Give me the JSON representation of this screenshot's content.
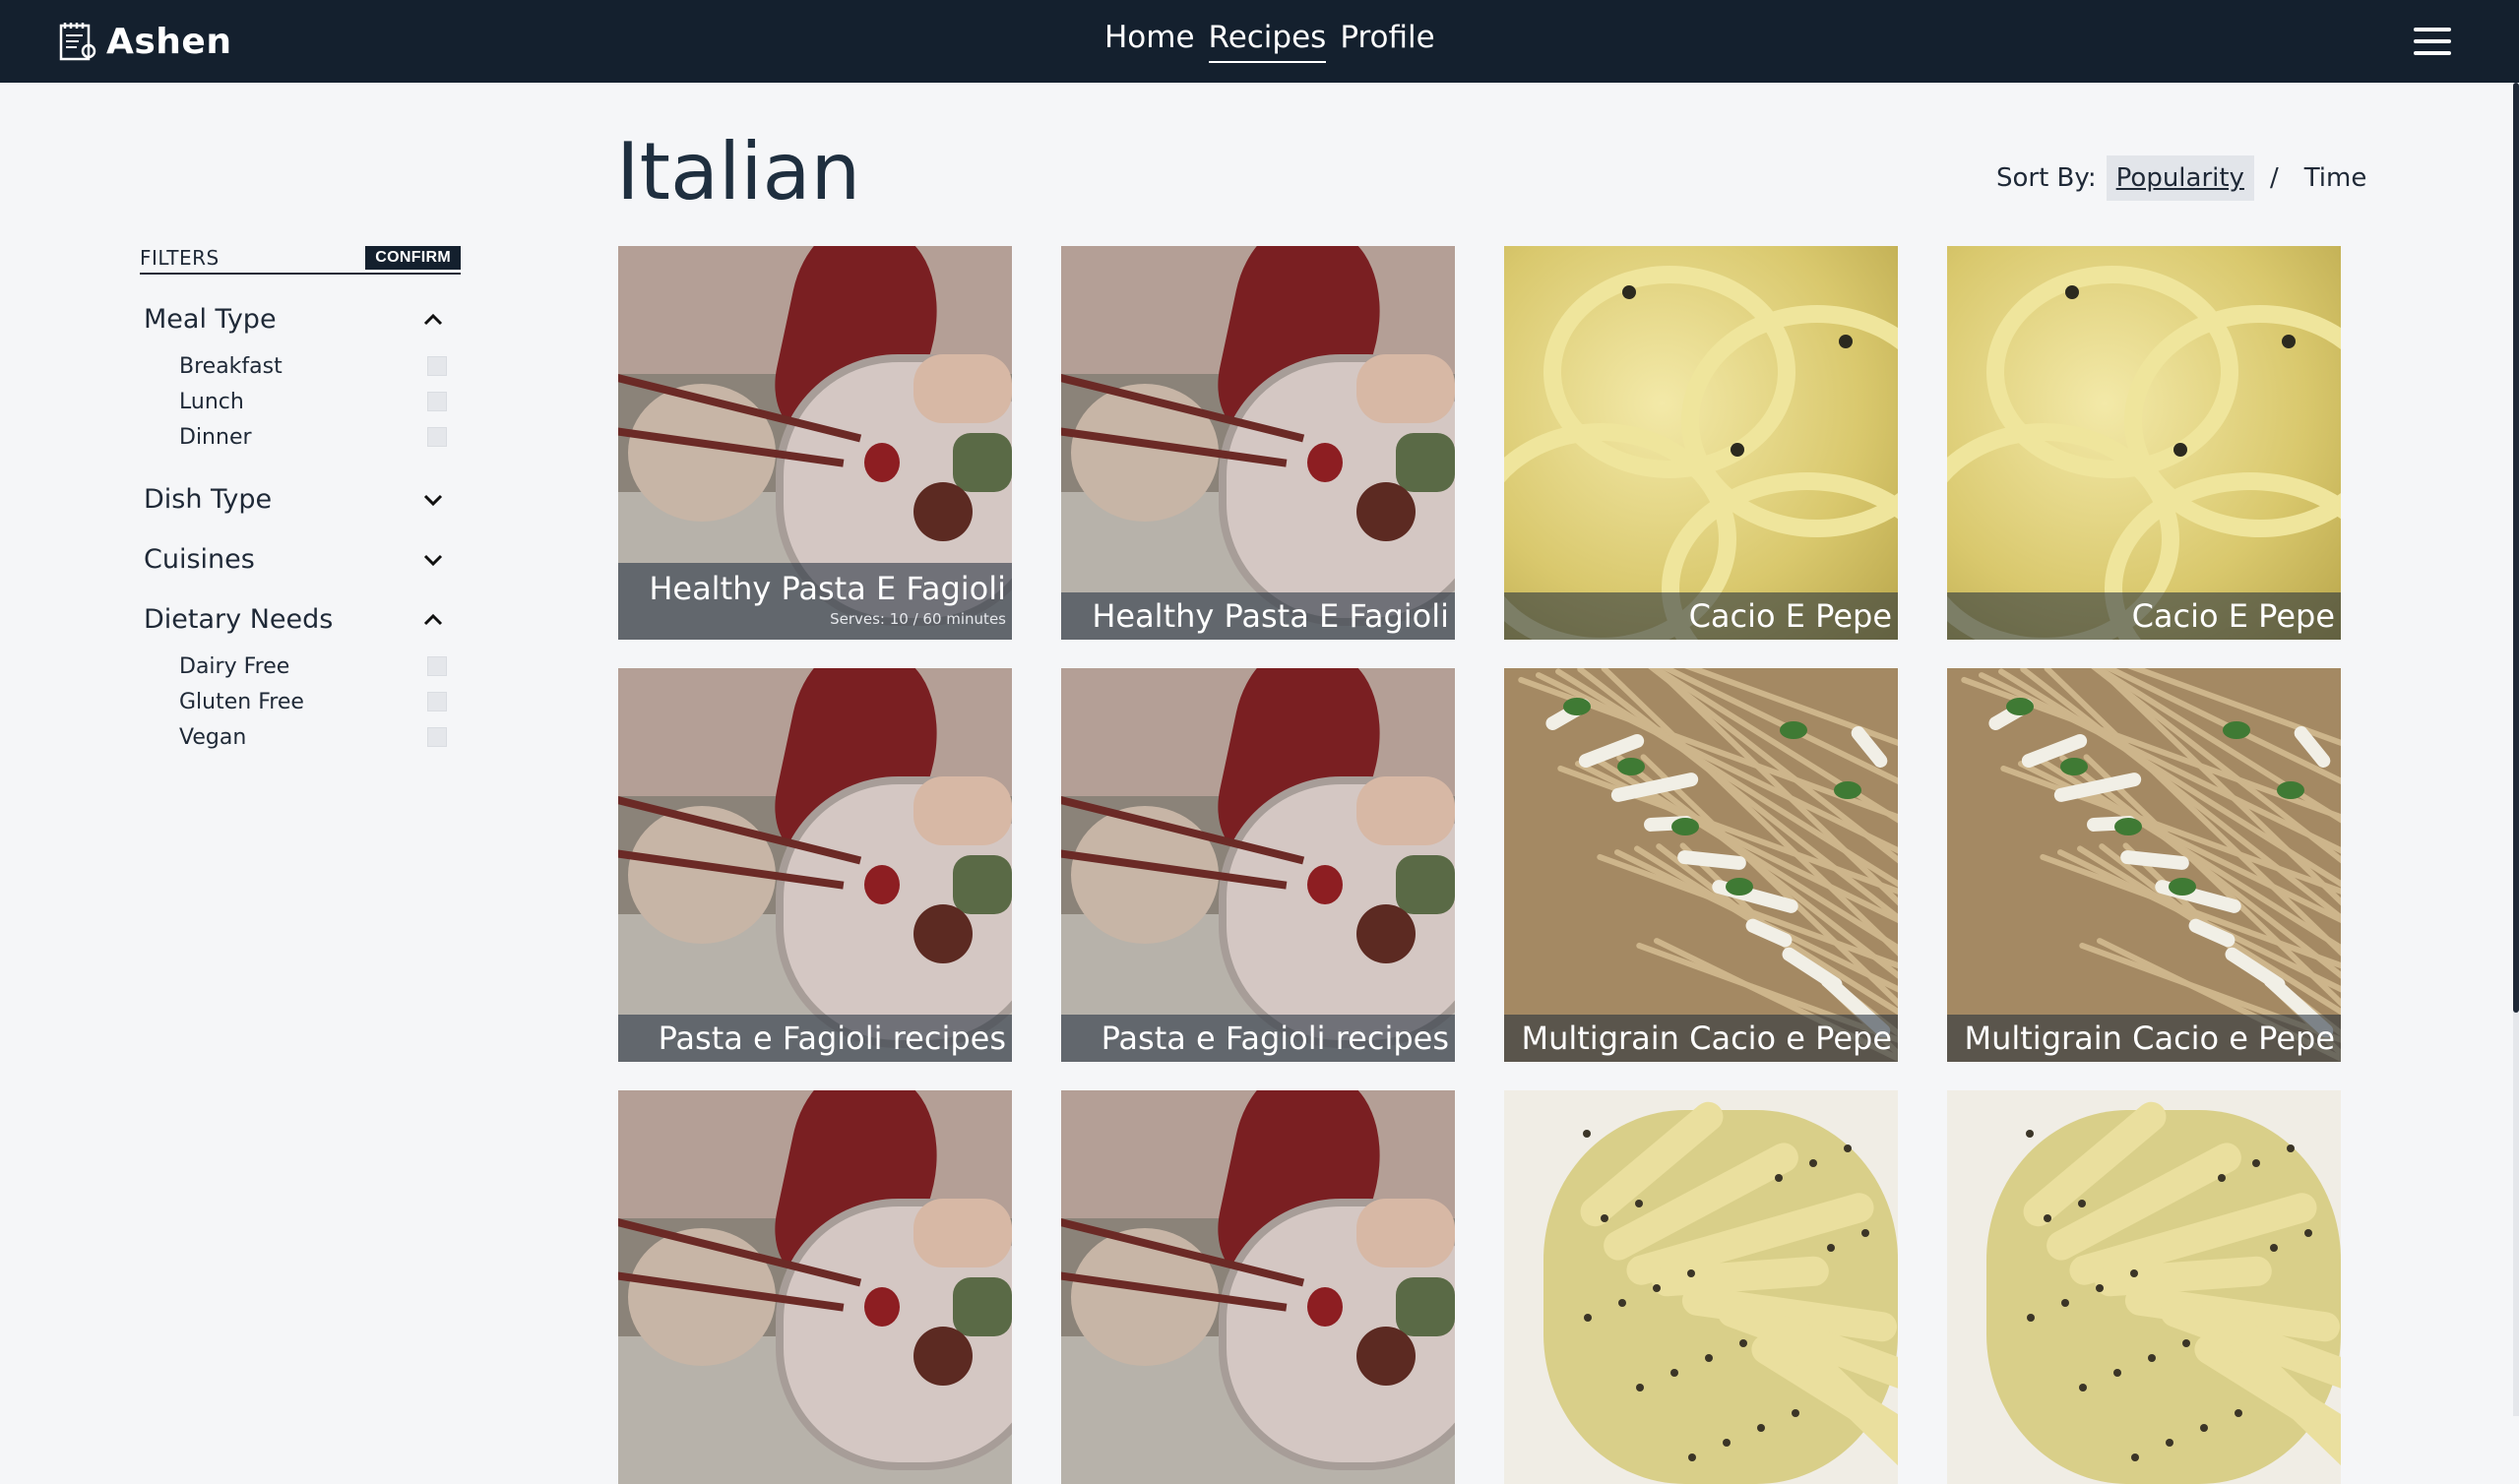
{
  "header": {
    "brand": "Ashen",
    "nav": [
      "Home",
      "Recipes",
      "Profile"
    ],
    "active_nav": "Recipes"
  },
  "page": {
    "title": "Italian",
    "sort_label": "Sort By:",
    "sort_options": [
      "Popularity",
      "Time"
    ],
    "sort_separator": "/",
    "active_sort": "Popularity"
  },
  "filters": {
    "label": "FILTERS",
    "confirm": "CONFIRM",
    "groups": [
      {
        "title": "Meal Type",
        "expanded": true,
        "options": [
          "Breakfast",
          "Lunch",
          "Dinner"
        ]
      },
      {
        "title": "Dish Type",
        "expanded": false,
        "options": []
      },
      {
        "title": "Cuisines",
        "expanded": false,
        "options": []
      },
      {
        "title": "Dietary Needs",
        "expanded": true,
        "options": [
          "Dairy Free",
          "Gluten Free",
          "Vegan"
        ]
      }
    ]
  },
  "recipes": [
    {
      "name": "Healthy Pasta E Fagioli",
      "meta": "Serves: 10 / 60 minutes",
      "image": "bento"
    },
    {
      "name": "Healthy Pasta E Fagioli",
      "meta": "",
      "image": "bento"
    },
    {
      "name": "Cacio E Pepe",
      "meta": "",
      "image": "cacio"
    },
    {
      "name": "Cacio E Pepe",
      "meta": "",
      "image": "cacio"
    },
    {
      "name": "Pasta e Fagioli recipes",
      "meta": "",
      "image": "bento"
    },
    {
      "name": "Pasta e Fagioli recipes",
      "meta": "",
      "image": "bento"
    },
    {
      "name": "Multigrain Cacio e Pepe",
      "meta": "",
      "image": "multi"
    },
    {
      "name": "Multigrain Cacio e Pepe",
      "meta": "",
      "image": "multi"
    },
    {
      "name": "",
      "meta": "",
      "image": "bento"
    },
    {
      "name": "",
      "meta": "",
      "image": "bento"
    },
    {
      "name": "",
      "meta": "",
      "image": "tagl"
    },
    {
      "name": "",
      "meta": "",
      "image": "tagl"
    }
  ],
  "colors": {
    "header_bg": "#14202e",
    "page_bg": "#f5f6f8",
    "caption_bg": "rgba(30,41,59,0.55)"
  }
}
